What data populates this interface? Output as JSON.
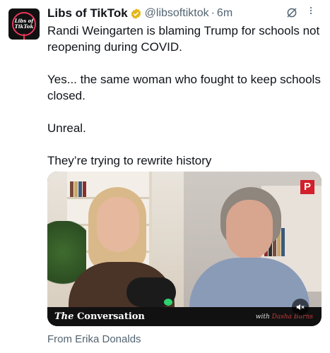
{
  "author": {
    "avatar_line1": "Libs of",
    "avatar_line2": "TikTok",
    "display_name": "Libs of TikTok",
    "handle": "@libsoftiktok",
    "separator": "·",
    "time": "6m",
    "verified": true
  },
  "tweet": {
    "lines": [
      "Randi Weingarten is blaming Trump for schools not reopening during COVID.",
      "Yes... the same woman who fought to keep schools closed.",
      "Unreal.",
      "They’re trying to rewrite history"
    ]
  },
  "video": {
    "brand_prefix": "The",
    "brand_name": "Conversation",
    "credit_prefix": "with",
    "credit_name": "Dasha Burns",
    "logo_letter": "P",
    "muted": true
  },
  "attribution": "From Erika Donalds",
  "colors": {
    "text": "#0f1419",
    "secondary": "#536471",
    "verified_gold": "#e2b719"
  },
  "icons": [
    "verified-badge-icon",
    "grok-icon",
    "more-icon",
    "mute-icon"
  ]
}
